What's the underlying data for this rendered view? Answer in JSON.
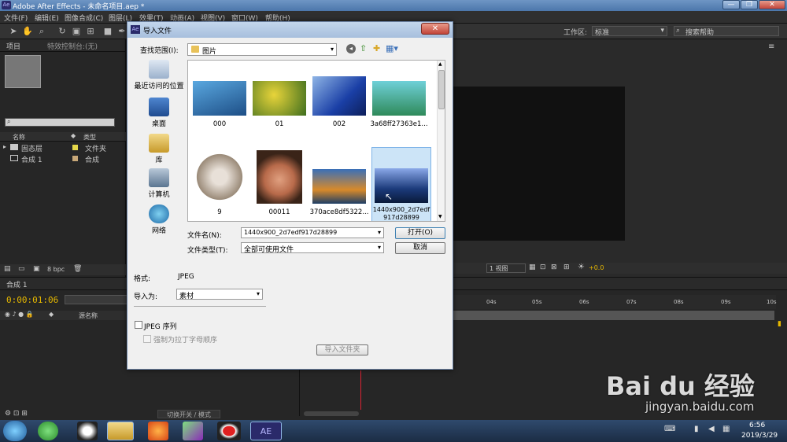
{
  "app": {
    "title": "Adobe After Effects - 未命名项目.aep *",
    "icon_label": "Ae"
  },
  "window_controls": {
    "minimize": "—",
    "maximize": "❐",
    "close": "✕"
  },
  "menu": [
    "文件(F)",
    "编辑(E)",
    "图像合成(C)",
    "图层(L)",
    "效果(T)",
    "动画(A)",
    "视图(V)",
    "窗口(W)",
    "帮助(H)"
  ],
  "toolbar": {
    "workspace_label": "工作区:",
    "workspace_value": "标准",
    "search_placeholder": "搜索帮助"
  },
  "project_panel": {
    "tab_project": "项目",
    "tab_effects": "特效控制台:(无)",
    "col_name": "名称",
    "col_type": "类型",
    "items": [
      {
        "name": "固态层",
        "type": "文件夹",
        "color": "#e6d84a"
      },
      {
        "name": "合成 1",
        "type": "合成",
        "color": "#c8a878"
      }
    ],
    "bpc": "8 bpc"
  },
  "comp_panel": {
    "view_label": "1 视图",
    "exposure": "+0.0"
  },
  "timeline": {
    "tab": "合成 1",
    "timecode": "0:00:01:06",
    "source_name": "源名称",
    "ruler": [
      "04s",
      "05s",
      "06s",
      "07s",
      "08s",
      "09s",
      "10s"
    ],
    "toggle_label": "切换开关 / 模式"
  },
  "dialog": {
    "title": "导入文件",
    "lookin_label": "查找范围(I):",
    "lookin_value": "图片",
    "places": [
      {
        "label": "最近访问的位置",
        "icon": "recent-places-icon"
      },
      {
        "label": "桌面",
        "icon": "desktop-icon"
      },
      {
        "label": "库",
        "icon": "library-icon"
      },
      {
        "label": "计算机",
        "icon": "computer-icon"
      },
      {
        "label": "网络",
        "icon": "network-icon"
      }
    ],
    "files": [
      {
        "name": "000",
        "color": "#3a7fb8",
        "color2": "#1d3e66"
      },
      {
        "name": "01",
        "color": "#d9c433",
        "color2": "#4a7a22"
      },
      {
        "name": "002",
        "color": "#1a3fa6",
        "color2": "#8fb5e6"
      },
      {
        "name": "3a68ff27363e1...",
        "color": "#2f8a5a",
        "color2": "#6fd0d8"
      },
      {
        "name": "9",
        "color": "#9a8a78",
        "color2": "#e8e0d8"
      },
      {
        "name": "00011",
        "color": "#b86a4a",
        "color2": "#3a2418"
      },
      {
        "name": "370ace8df5322...",
        "color": "#3a6fb8",
        "color2": "#d88a2a"
      },
      {
        "name": "1440x900_2d7edf917d28899",
        "color": "#1b3a7a",
        "color2": "#8aa8e8"
      }
    ],
    "filename_label": "文件名(N):",
    "filename_value": "1440x900_2d7edf917d28899",
    "filetype_label": "文件类型(T):",
    "filetype_value": "全部可使用文件",
    "open_button": "打开(O)",
    "cancel_button": "取消",
    "format_label": "格式:",
    "format_value": "JPEG",
    "import_as_label": "导入为:",
    "import_as_value": "素材",
    "jpeg_sequence": "JPEG 序列",
    "force_alpha": "强制为拉丁字母顺序",
    "import_folder_button": "导入文件夹"
  },
  "taskbar": {
    "time": "6:56",
    "date": "2019/3/29",
    "active_app": "AE"
  },
  "watermark": {
    "brand": "Bai du 经验",
    "url": "jingyan.baidu.com"
  }
}
